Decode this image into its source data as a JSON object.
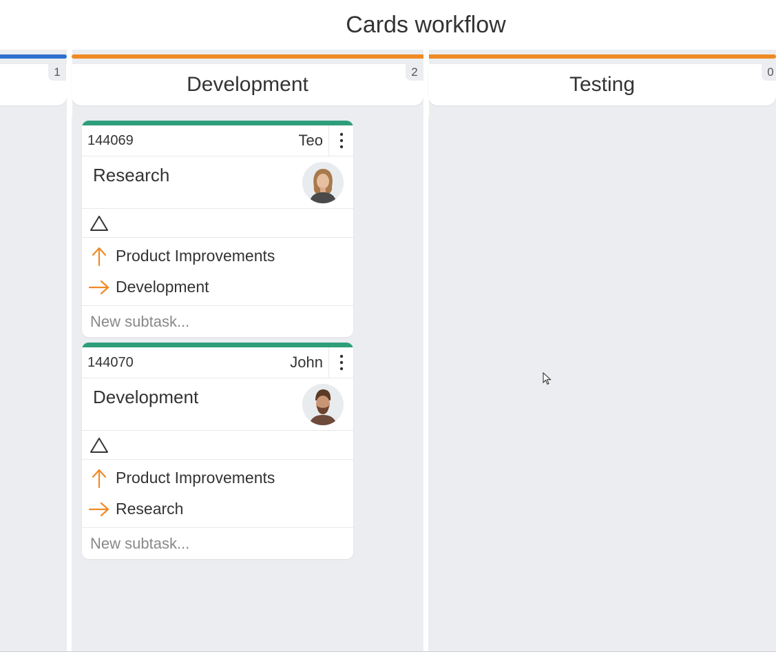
{
  "header": {
    "title": "Cards workflow"
  },
  "columns": [
    {
      "title": "",
      "count": "1",
      "accent_color": "#2f6fd0"
    },
    {
      "title": "Development",
      "count": "2",
      "accent_color": "#f08a24"
    },
    {
      "title": "Testing",
      "count": "0",
      "accent_color": "#f08a24"
    }
  ],
  "cards": [
    {
      "id": "144069",
      "owner": "Teo",
      "name": "Research",
      "avatar_icon": "female-avatar",
      "priority_icon": "triangle-outline-icon",
      "links": [
        {
          "icon": "arrow-up-icon",
          "label": "Product Improvements"
        },
        {
          "icon": "arrow-right-icon",
          "label": "Development"
        }
      ],
      "subtask_placeholder": "New subtask...",
      "stripe_color": "#2e9e7a"
    },
    {
      "id": "144070",
      "owner": "John",
      "name": "Development",
      "avatar_icon": "male-avatar",
      "priority_icon": "triangle-outline-icon",
      "links": [
        {
          "icon": "arrow-up-icon",
          "label": "Product Improvements"
        },
        {
          "icon": "arrow-right-icon",
          "label": "Research"
        }
      ],
      "subtask_placeholder": "New subtask...",
      "stripe_color": "#2e9e7a"
    }
  ],
  "colors": {
    "link_arrow": "#f08a24",
    "board_background": "#ebedf0"
  }
}
